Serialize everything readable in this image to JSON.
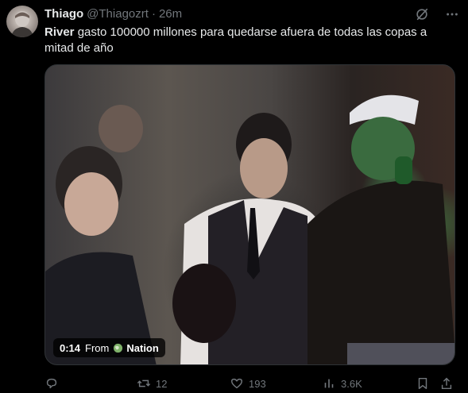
{
  "tweet": {
    "display_name": "Thiago",
    "handle": "@Thiagozrt",
    "separator": "·",
    "time": "26m",
    "text_bold": "River",
    "text_rest": " gasto 100000 millones para quedarse afuera de todas las copas a mitad de año",
    "header_icons": [
      "grok-slash-icon",
      "more-icon"
    ]
  },
  "media": {
    "duration": "0:14",
    "from_label": "From",
    "source_name": "Nation",
    "source_icon": "globe-icon"
  },
  "actions": {
    "reply_count": "",
    "retweet_count": "12",
    "like_count": "193",
    "views_count": "3.6K",
    "icons": [
      "reply-icon",
      "retweet-icon",
      "like-icon",
      "views-icon",
      "bookmark-icon",
      "share-icon"
    ]
  },
  "colors": {
    "background": "#000000",
    "text_primary": "#e7e9ea",
    "text_secondary": "#71767b",
    "border": "#2f3336"
  }
}
